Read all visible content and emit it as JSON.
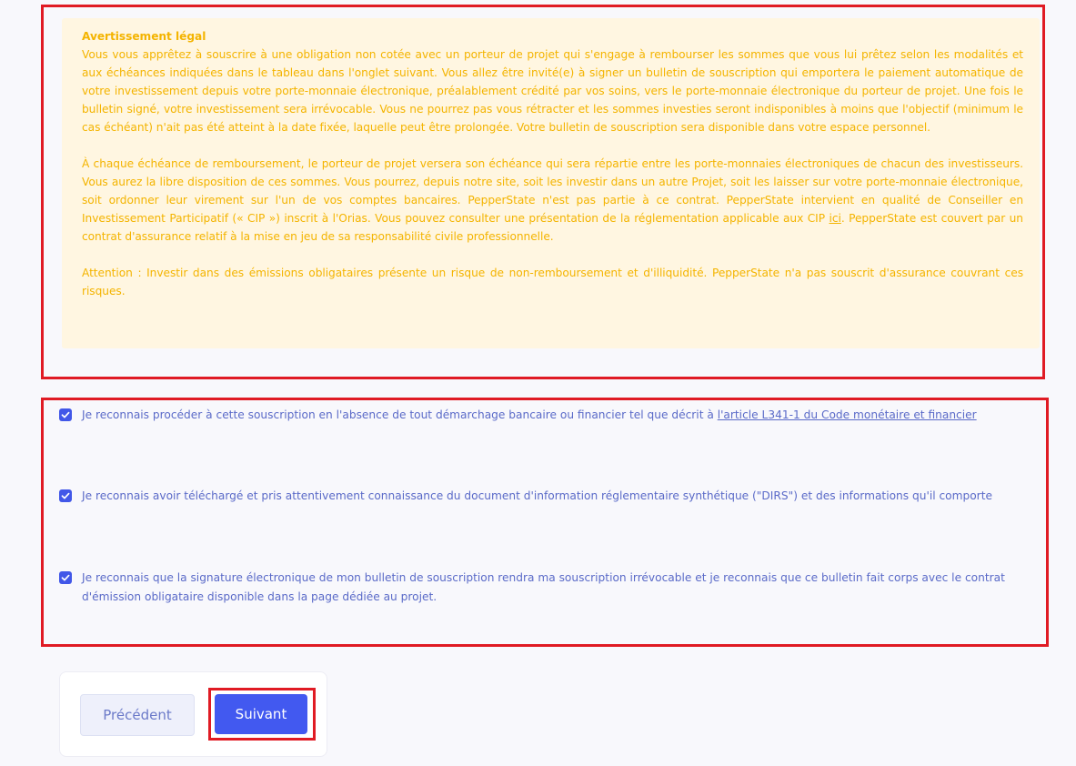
{
  "legal": {
    "title": "Avertissement légal",
    "paragraph1": "Vous vous apprêtez à souscrire à une obligation non cotée avec un porteur de projet qui s'engage à rembourser les sommes que vous lui prêtez selon les modalités et aux échéances indiquées dans le tableau dans l'onglet suivant. Vous allez être invité(e) à signer un bulletin de souscription qui emportera le paiement automatique de votre investissement depuis votre porte-monnaie électronique, préalablement crédité par vos soins, vers le porte-monnaie électronique du porteur de projet. Une fois le bulletin signé, votre investissement sera irrévocable. Vous ne pourrez pas vous rétracter et les sommes investies seront indisponibles à moins que l'objectif (minimum le cas échéant) n'ait pas été atteint à la date fixée, laquelle peut être prolongée. Votre bulletin de souscription sera disponible dans votre espace personnel.",
    "paragraph2_before_link": "À chaque échéance de remboursement, le porteur de projet versera son échéance qui sera répartie entre les porte-monnaies électroniques de chacun des investisseurs. Vous aurez la libre disposition de ces sommes. Vous pourrez, depuis notre site, soit les investir dans un autre Projet, soit les laisser sur votre porte-monnaie électronique, soit ordonner leur virement sur l'un de vos comptes bancaires. PepperState n'est pas partie à ce contrat. PepperState intervient en qualité de Conseiller en Investissement Participatif (« CIP ») inscrit à l'Orias. Vous pouvez consulter une présentation de la réglementation applicable aux CIP ",
    "paragraph2_link": "ici",
    "paragraph2_after_link": ". PepperState est couvert par un contrat d'assurance relatif à la mise en jeu de sa responsabilité civile professionnelle.",
    "paragraph3": "Attention : Investir dans des émissions obligataires présente un risque de non-remboursement et d'illiquidité. PepperState n'a pas souscrit d'assurance couvrant ces risques."
  },
  "checks": [
    {
      "checked": true,
      "text_before_link": "Je reconnais procéder à cette souscription en l'absence de tout démarchage bancaire ou financier tel que décrit à ",
      "link": "l'article L341-1 du Code monétaire et financier",
      "text_after_link": ""
    },
    {
      "checked": true,
      "text": "Je reconnais avoir téléchargé et pris attentivement connaissance du document d'information réglementaire synthétique (\"DIRS\") et des informations qu'il comporte"
    },
    {
      "checked": true,
      "text": "Je reconnais que la signature électronique de mon bulletin de souscription rendra ma souscription irrévocable et je reconnais que ce bulletin fait corps avec le contrat d'émission obligataire disponible dans la page dédiée au projet."
    }
  ],
  "buttons": {
    "previous_label": "Précédent",
    "next_label": "Suivant"
  },
  "colors": {
    "warning_text": "#f4b400",
    "warning_background": "#fff6e1",
    "highlight_border": "#e01b24",
    "checkbox": "#4157e8",
    "check_text": "#5a6ac8",
    "primary_button": "#4259f0"
  },
  "icons": {
    "checkbox": "checkmark-icon"
  }
}
